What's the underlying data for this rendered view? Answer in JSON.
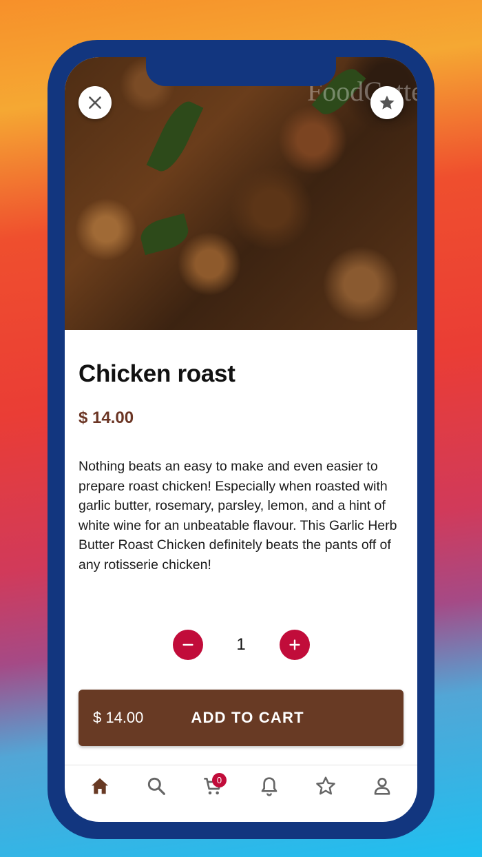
{
  "product": {
    "title": "Chicken roast",
    "price": "$ 14.00",
    "description": "Nothing beats an easy to make and even easier to prepare roast chicken! Especially when roasted with garlic butter, rosemary, parsley, lemon, and a hint of white wine for an unbeatable flavour. This Garlic Herb Butter Roast Chicken definitely beats the pants off of any rotisserie chicken!",
    "image_watermark": "FoodCutter"
  },
  "quantity": {
    "value": "1",
    "decrement_icon": "minus-icon",
    "increment_icon": "plus-icon"
  },
  "cart_button": {
    "price": "$ 14.00",
    "label": "ADD TO CART"
  },
  "header_buttons": {
    "close_icon": "close-icon",
    "favorite_icon": "star-icon"
  },
  "nav": {
    "items": [
      {
        "icon": "home-icon",
        "active": true
      },
      {
        "icon": "search-icon",
        "active": false
      },
      {
        "icon": "cart-icon",
        "active": false,
        "badge": "0"
      },
      {
        "icon": "bell-icon",
        "active": false
      },
      {
        "icon": "star-outline-icon",
        "active": false
      },
      {
        "icon": "user-icon",
        "active": false
      }
    ]
  },
  "colors": {
    "accent": "#c10c3a",
    "brand_brown": "#683a24",
    "price_text": "#6b3524",
    "phone_frame": "#12367f"
  }
}
